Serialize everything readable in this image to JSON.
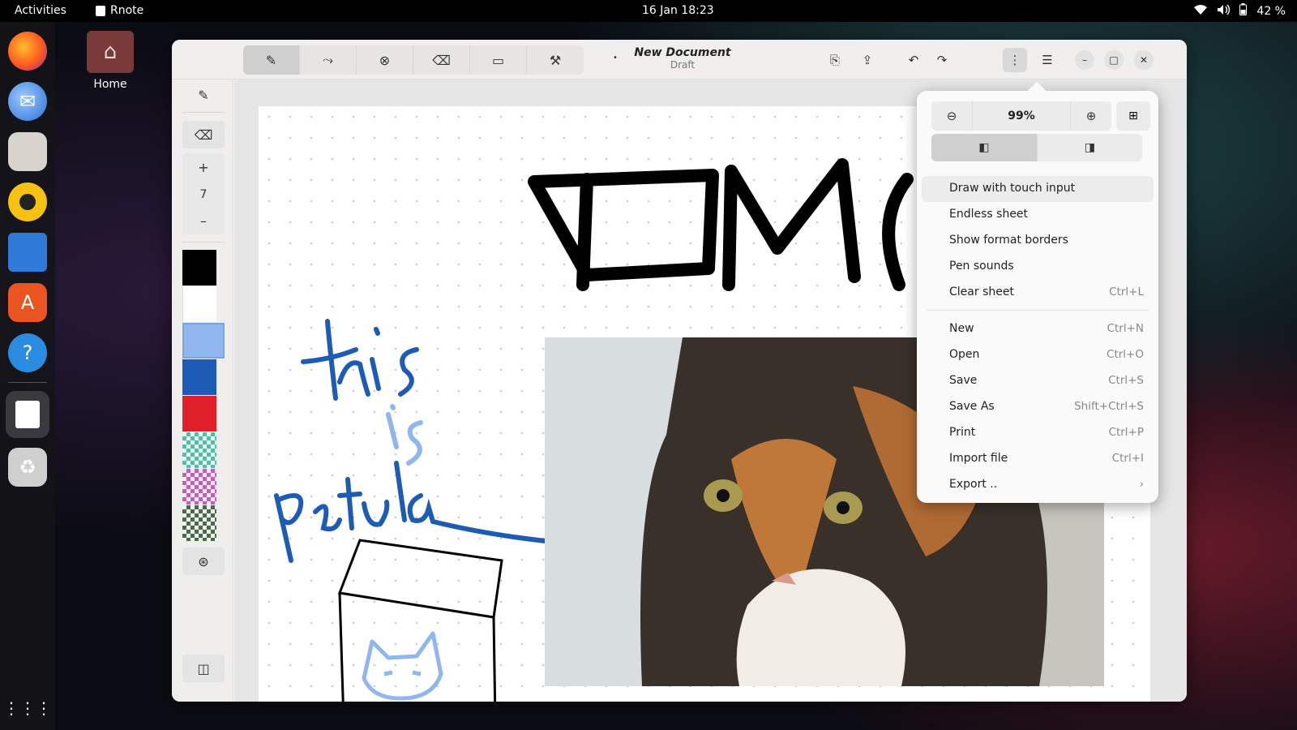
{
  "topbar": {
    "activities": "Activities",
    "app_name": "Rnote",
    "clock": "16 Jan  18:23",
    "battery": "42 %"
  },
  "desktop": {
    "home_label": "Home"
  },
  "window": {
    "doc_title": "New Document",
    "doc_subtitle": "Draft"
  },
  "sidebar": {
    "stroke_width": "7"
  },
  "colors": {
    "swatches": [
      "#000000",
      "#ffffff",
      "#8fb6ee",
      "#1c5bb6",
      "#e0202a"
    ]
  },
  "menu": {
    "zoom": "99%",
    "items": [
      {
        "label": "Draw with touch input",
        "shortcut": ""
      },
      {
        "label": "Endless sheet",
        "shortcut": ""
      },
      {
        "label": "Show format borders",
        "shortcut": ""
      },
      {
        "label": "Pen sounds",
        "shortcut": ""
      },
      {
        "label": "Clear sheet",
        "shortcut": "Ctrl+L"
      },
      {
        "label": "New",
        "shortcut": "Ctrl+N"
      },
      {
        "label": "Open",
        "shortcut": "Ctrl+O"
      },
      {
        "label": "Save",
        "shortcut": "Ctrl+S"
      },
      {
        "label": "Save As",
        "shortcut": "Shift+Ctrl+S"
      },
      {
        "label": "Print",
        "shortcut": "Ctrl+P"
      },
      {
        "label": "Import file",
        "shortcut": "Ctrl+I"
      },
      {
        "label": "Export ..",
        "shortcut": "›"
      }
    ]
  }
}
